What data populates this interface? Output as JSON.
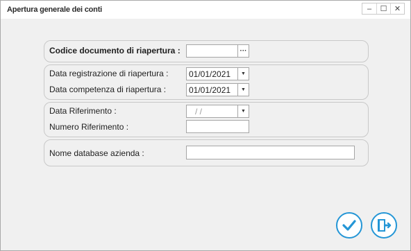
{
  "window": {
    "title": "Apertura generale dei conti",
    "buttons": {
      "minimize": "‒",
      "maximize": "☐",
      "close": "✕"
    }
  },
  "form": {
    "codice_label": "Codice documento di riapertura :",
    "codice_value": "",
    "codice_button": "···",
    "data_registrazione_label": "Data registrazione di riapertura :",
    "data_registrazione_value": "01/01/2021",
    "data_competenza_label": "Data competenza di riapertura :",
    "data_competenza_value": "01/01/2021",
    "data_riferimento_label": "Data Riferimento :",
    "data_riferimento_value": " /  /",
    "numero_riferimento_label": "Numero Riferimento :",
    "numero_riferimento_value": "",
    "nome_database_label": "Nome database azienda :",
    "nome_database_value": ""
  },
  "actions": {
    "confirm_icon": "checkmark-icon",
    "exit_icon": "exit-door-icon",
    "accent_color": "#2496d6"
  }
}
